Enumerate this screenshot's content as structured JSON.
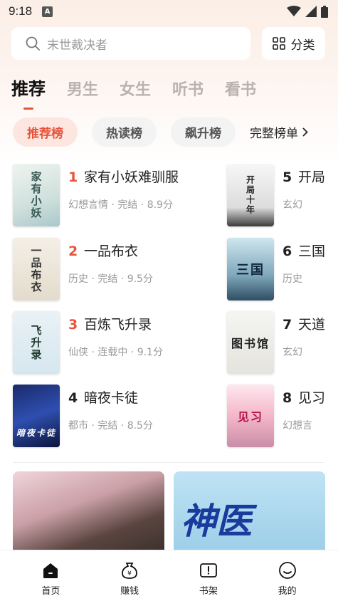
{
  "status_bar": {
    "time": "9:18",
    "notification_letter": "A"
  },
  "search": {
    "placeholder": "末世裁决者"
  },
  "category_button": {
    "label": "分类"
  },
  "tabs": [
    {
      "label": "推荐",
      "active": true
    },
    {
      "label": "男生",
      "active": false
    },
    {
      "label": "女生",
      "active": false
    },
    {
      "label": "听书",
      "active": false
    },
    {
      "label": "看书",
      "active": false
    }
  ],
  "chips": [
    {
      "label": "推荐榜",
      "active": true
    },
    {
      "label": "热读榜",
      "active": false
    },
    {
      "label": "飙升榜",
      "active": false
    }
  ],
  "full_list_link": {
    "label": "完整榜单"
  },
  "ranking": [
    {
      "rank": "1",
      "title": "家有小妖难驯服",
      "meta": "幻想言情 · 完结 · 8.9分",
      "cover_text": "家有小妖"
    },
    {
      "rank": "2",
      "title": "一品布衣",
      "meta": "历史 · 完结 · 9.5分",
      "cover_text": "一品布衣"
    },
    {
      "rank": "3",
      "title": "百炼飞升录",
      "meta": "仙侠 · 连载中 · 9.1分",
      "cover_text": "飞升录"
    },
    {
      "rank": "4",
      "title": "暗夜卡徒",
      "meta": "都市 · 完结 · 8.5分",
      "cover_text": "暗夜卡徒"
    },
    {
      "rank": "5",
      "title": "开局",
      "meta": "玄幻",
      "cover_text": "开局十年"
    },
    {
      "rank": "6",
      "title": "三国",
      "meta": "历史",
      "cover_text": "三国"
    },
    {
      "rank": "7",
      "title": "天道",
      "meta": "玄幻",
      "cover_text": "图书馆"
    },
    {
      "rank": "8",
      "title": "见习",
      "meta": "幻想言",
      "cover_text": "见习"
    }
  ],
  "banners": {
    "right_text": "神医"
  },
  "bottom_nav": [
    {
      "label": "首页",
      "icon": "home-icon",
      "active": true
    },
    {
      "label": "赚钱",
      "icon": "money-bag-icon",
      "active": false
    },
    {
      "label": "书架",
      "icon": "bookshelf-icon",
      "active": false
    },
    {
      "label": "我的",
      "icon": "profile-icon",
      "active": false
    }
  ],
  "colors": {
    "accent": "#e8533a",
    "chip_active_bg": "#fde6df"
  }
}
